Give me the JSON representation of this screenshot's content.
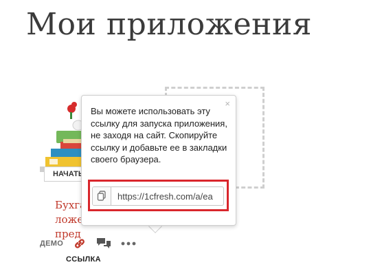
{
  "page": {
    "title": "Мои приложения"
  },
  "app": {
    "name_visible": "Бухгалтерия предприятия",
    "name_part1": "Бухга",
    "name_part2": "ложение",
    "name_part3": "пред",
    "start_label": "НАЧАТЬ",
    "actions": {
      "demo_label": "ДЕМО",
      "link_label": "ССЫЛКА"
    }
  },
  "popover": {
    "text": "Вы можете использовать эту ссылку для запуска приложения, не заходя на сайт. Скопируйте ссылку и добавьте ее в закладки своего браузера.",
    "close_glyph": "×",
    "url_value": "https://1cfresh.com/a/ea"
  },
  "colors": {
    "accent_red": "#c0392b",
    "highlight_red": "#d9262c",
    "title_gray": "#3b3b3b"
  }
}
